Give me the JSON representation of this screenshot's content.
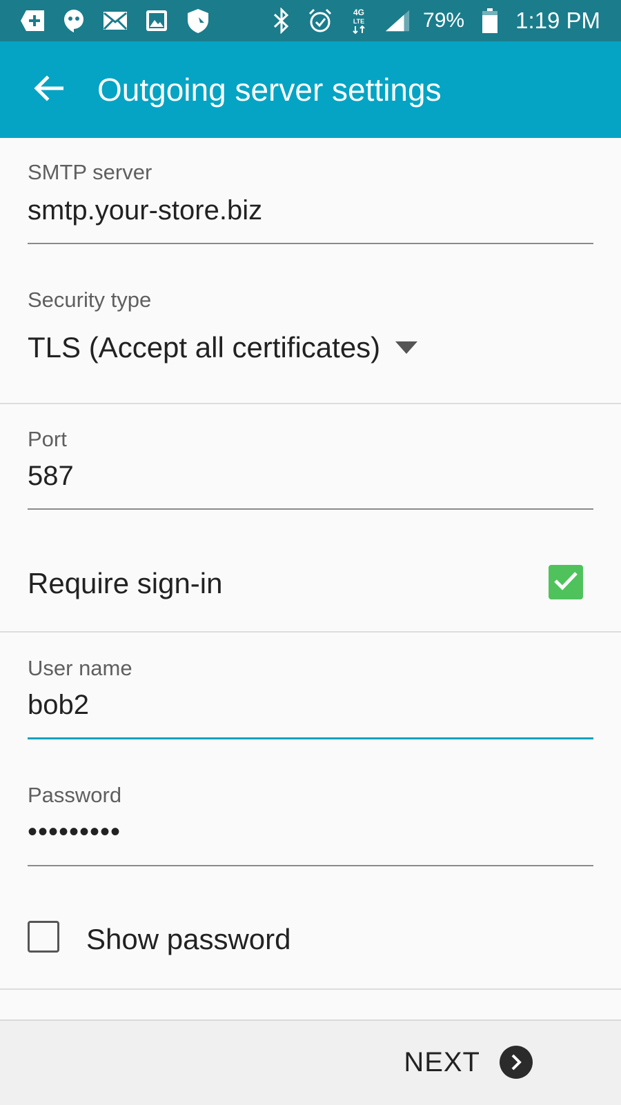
{
  "status_bar": {
    "battery": "79%",
    "time": "1:19 PM",
    "network": "4G LTE"
  },
  "app_bar": {
    "title": "Outgoing server settings",
    "back_icon": "arrow-back-icon"
  },
  "form": {
    "smtp": {
      "label": "SMTP server",
      "value": "smtp.your-store.biz"
    },
    "security": {
      "label": "Security type",
      "value": "TLS (Accept all certificates)"
    },
    "port": {
      "label": "Port",
      "value": "587"
    },
    "require_signin": {
      "label": "Require sign-in",
      "checked": true
    },
    "username": {
      "label": "User name",
      "value": "bob2"
    },
    "password": {
      "label": "Password",
      "value": "•••••••••"
    },
    "show_password": {
      "label": "Show password",
      "checked": false
    }
  },
  "footer": {
    "next_label": "NEXT"
  },
  "colors": {
    "status_bar": "#1b7c8c",
    "app_bar": "#05a4c4",
    "checkbox_checked": "#4fc25c",
    "active_underline": "#13a2bf"
  }
}
